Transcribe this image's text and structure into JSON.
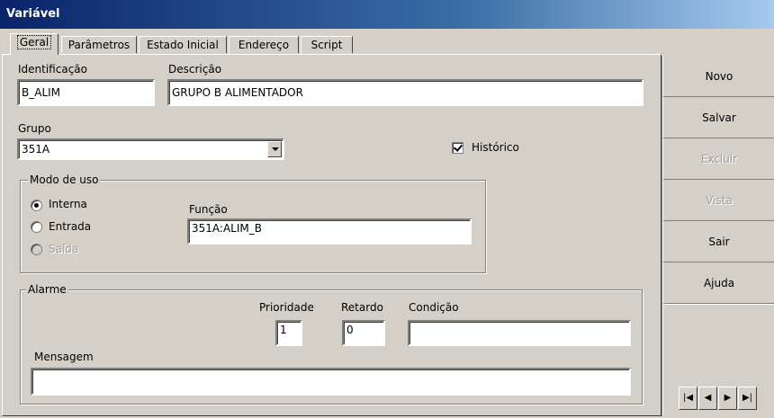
{
  "window": {
    "title": "Variável"
  },
  "tabs": [
    {
      "label": "Geral",
      "active": true
    },
    {
      "label": "Parâmetros"
    },
    {
      "label": "Estado Inicial"
    },
    {
      "label": "Endereço"
    },
    {
      "label": "Script"
    }
  ],
  "fields": {
    "identificacao": {
      "label": "Identificação",
      "value": "B_ALIM"
    },
    "descricao": {
      "label": "Descrição",
      "value": "GRUPO B ALIMENTADOR"
    },
    "grupo": {
      "label": "Grupo",
      "value": "351A"
    },
    "historico": {
      "label": "Histórico",
      "checked": true
    }
  },
  "modo_de_uso": {
    "legend": "Modo de uso",
    "options": [
      {
        "label": "Interna",
        "selected": true,
        "enabled": true
      },
      {
        "label": "Entrada",
        "selected": false,
        "enabled": true
      },
      {
        "label": "Saída",
        "selected": false,
        "enabled": false
      }
    ],
    "funcao": {
      "label": "Função",
      "value": "351A:ALIM_B"
    }
  },
  "alarme": {
    "legend": "Alarme",
    "prioridade": {
      "label": "Prioridade",
      "value": "1"
    },
    "retardo": {
      "label": "Retardo",
      "value": "0"
    },
    "condicao": {
      "label": "Condição",
      "value": ""
    },
    "mensagem": {
      "label": "Mensagem",
      "value": ""
    }
  },
  "actions": [
    {
      "label": "Novo",
      "enabled": true
    },
    {
      "label": "Salvar",
      "enabled": true
    },
    {
      "label": "Excluir",
      "enabled": false
    },
    {
      "label": "Vista",
      "enabled": false
    },
    {
      "label": "Sair",
      "enabled": true
    },
    {
      "label": "Ajuda",
      "enabled": true
    }
  ],
  "navigator": {
    "icons": [
      "first-record-icon",
      "prev-record-icon",
      "next-record-icon",
      "last-record-icon"
    ],
    "glyphs": [
      "|◀",
      "◀",
      "▶",
      "▶|"
    ]
  },
  "colors": {
    "title_start": "#0a246a",
    "title_end": "#a6caf0",
    "face": "#d4d0c8"
  }
}
